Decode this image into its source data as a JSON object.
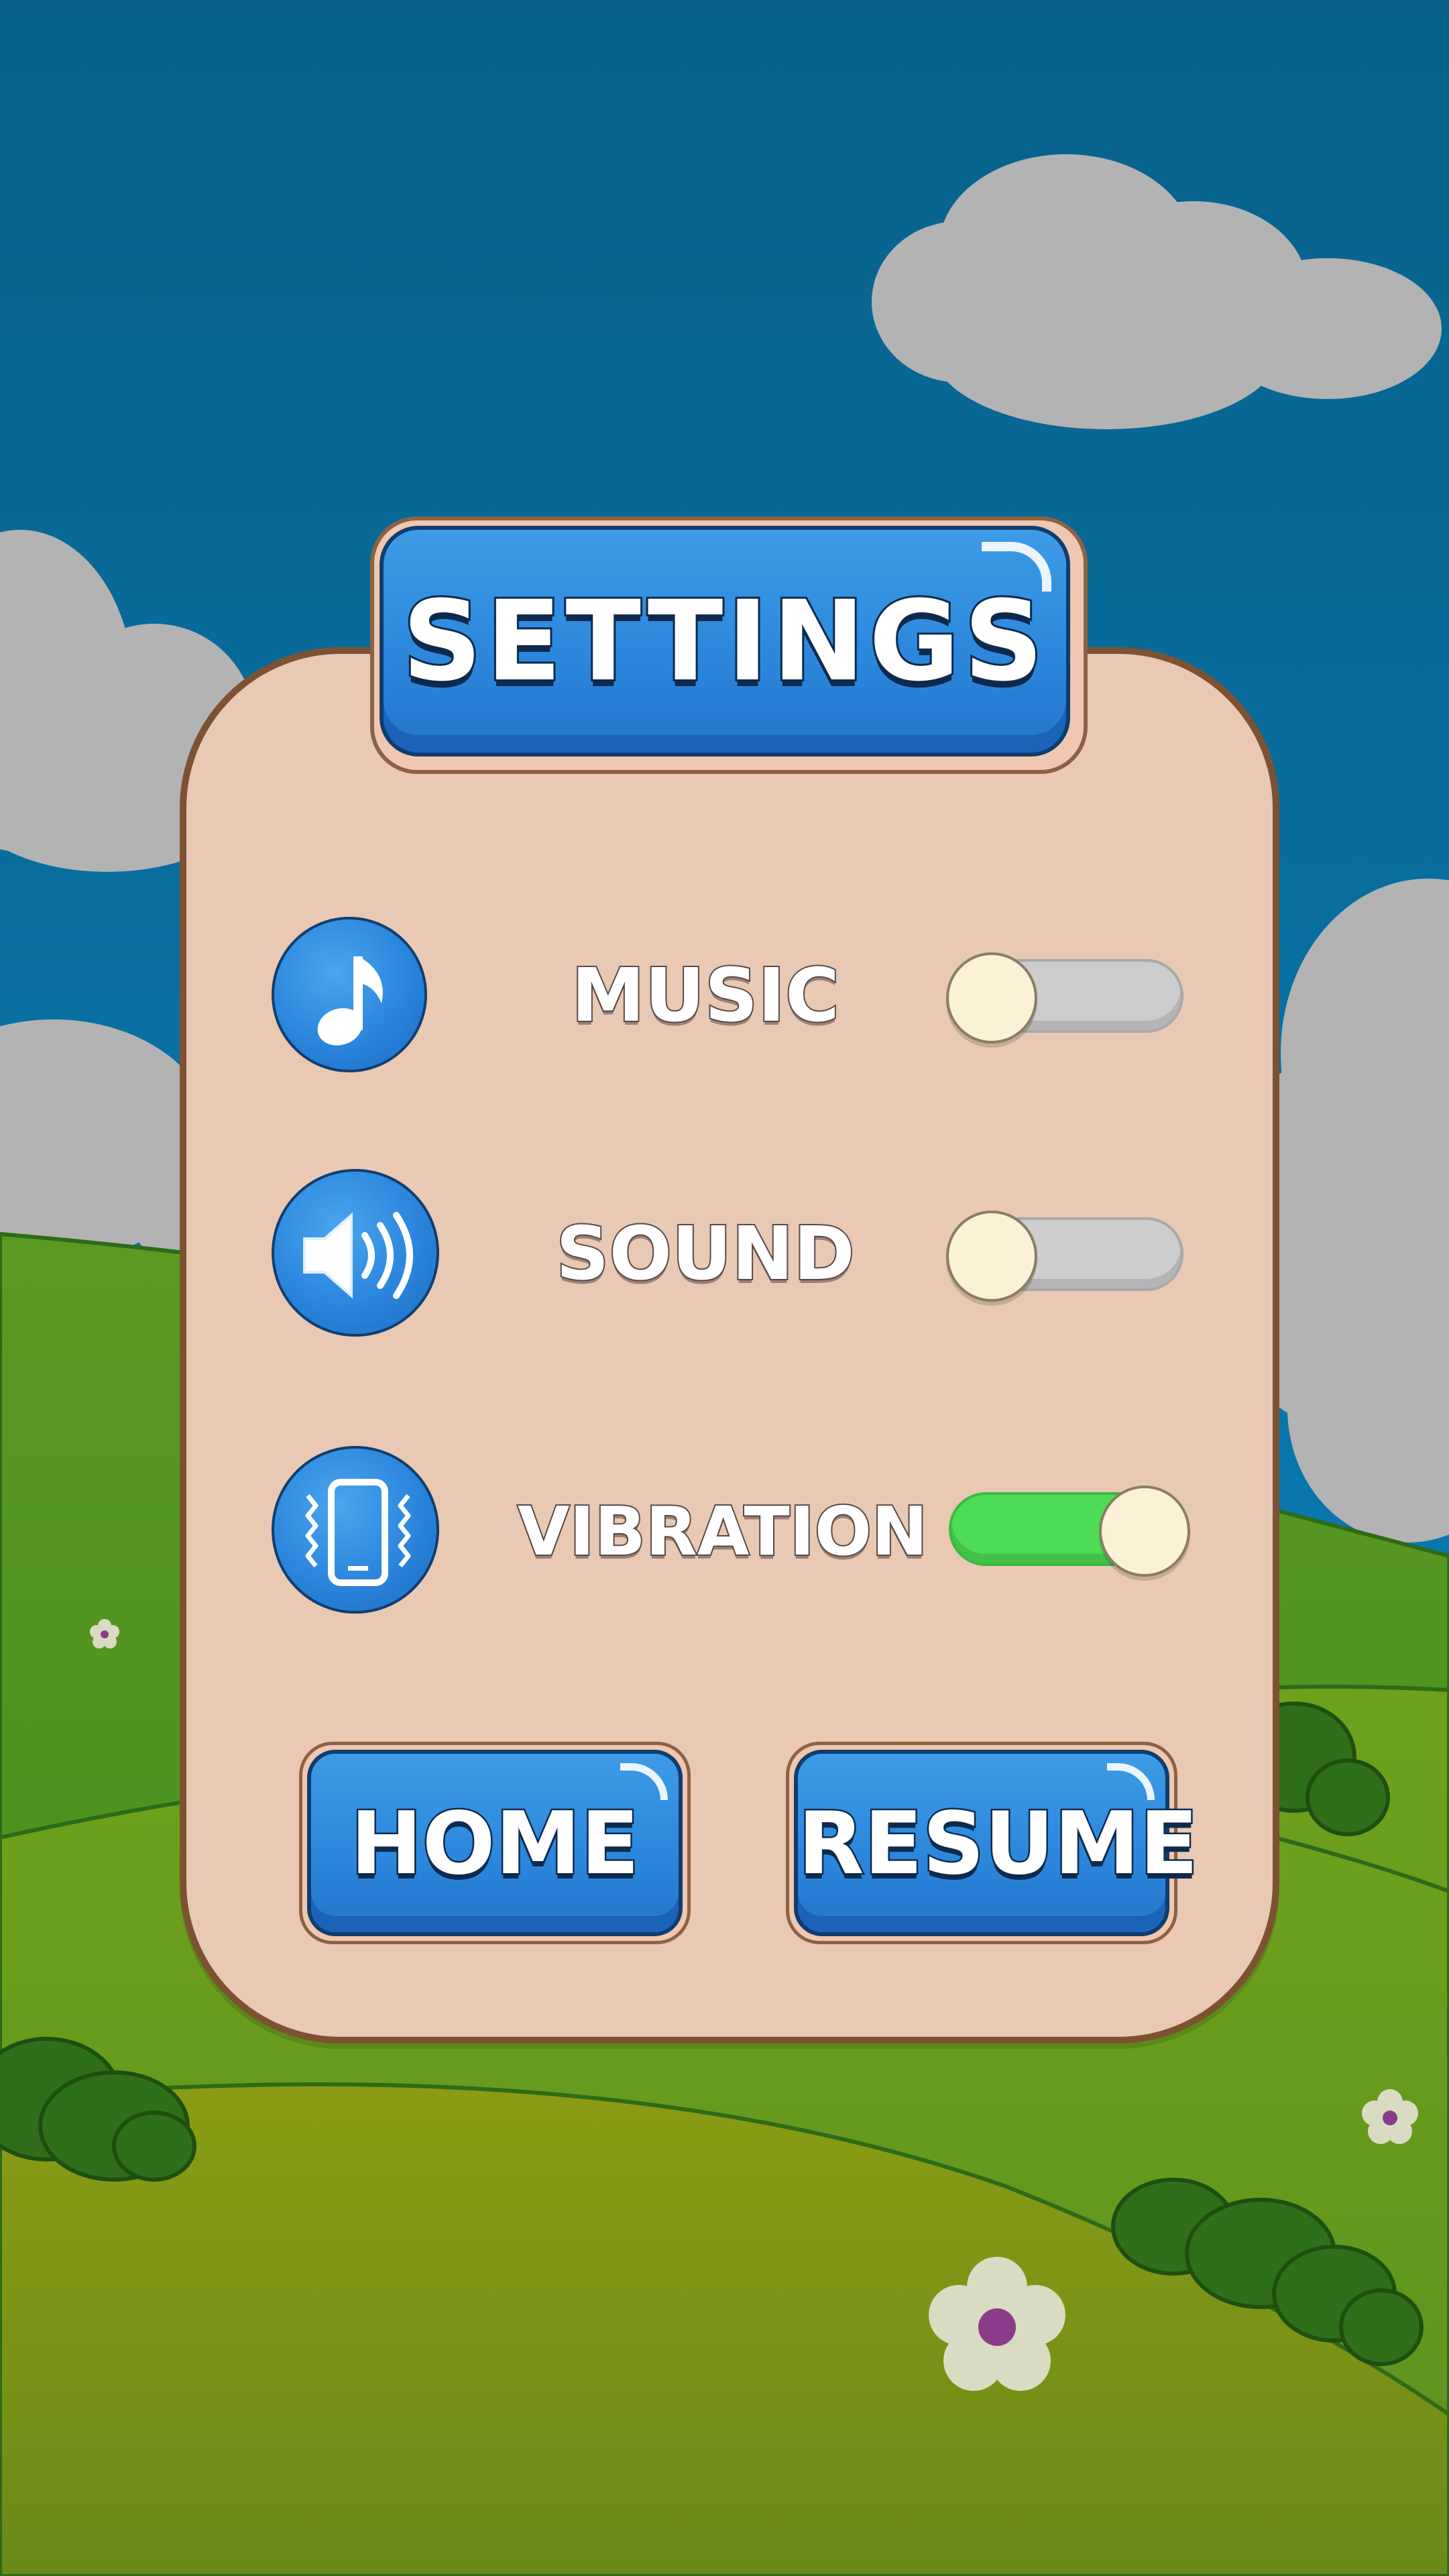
{
  "screen": {
    "title": "SETTINGS"
  },
  "settings": [
    {
      "label": "MUSIC",
      "icon": "music-note-icon",
      "enabled": false
    },
    {
      "label": "SOUND",
      "icon": "speaker-icon",
      "enabled": false
    },
    {
      "label": "VIBRATION",
      "icon": "phone-vibration-icon",
      "enabled": true
    }
  ],
  "buttons": {
    "home": "HOME",
    "resume": "RESUME"
  },
  "colors": {
    "sky": "#0e73a6",
    "panel": "#e9c8b4",
    "panel_border": "#7d5232",
    "button_blue": "#2b86dc",
    "toggle_on": "#4cdc55",
    "toggle_off": "#cdcdcd",
    "knob": "#fbf1d6"
  }
}
